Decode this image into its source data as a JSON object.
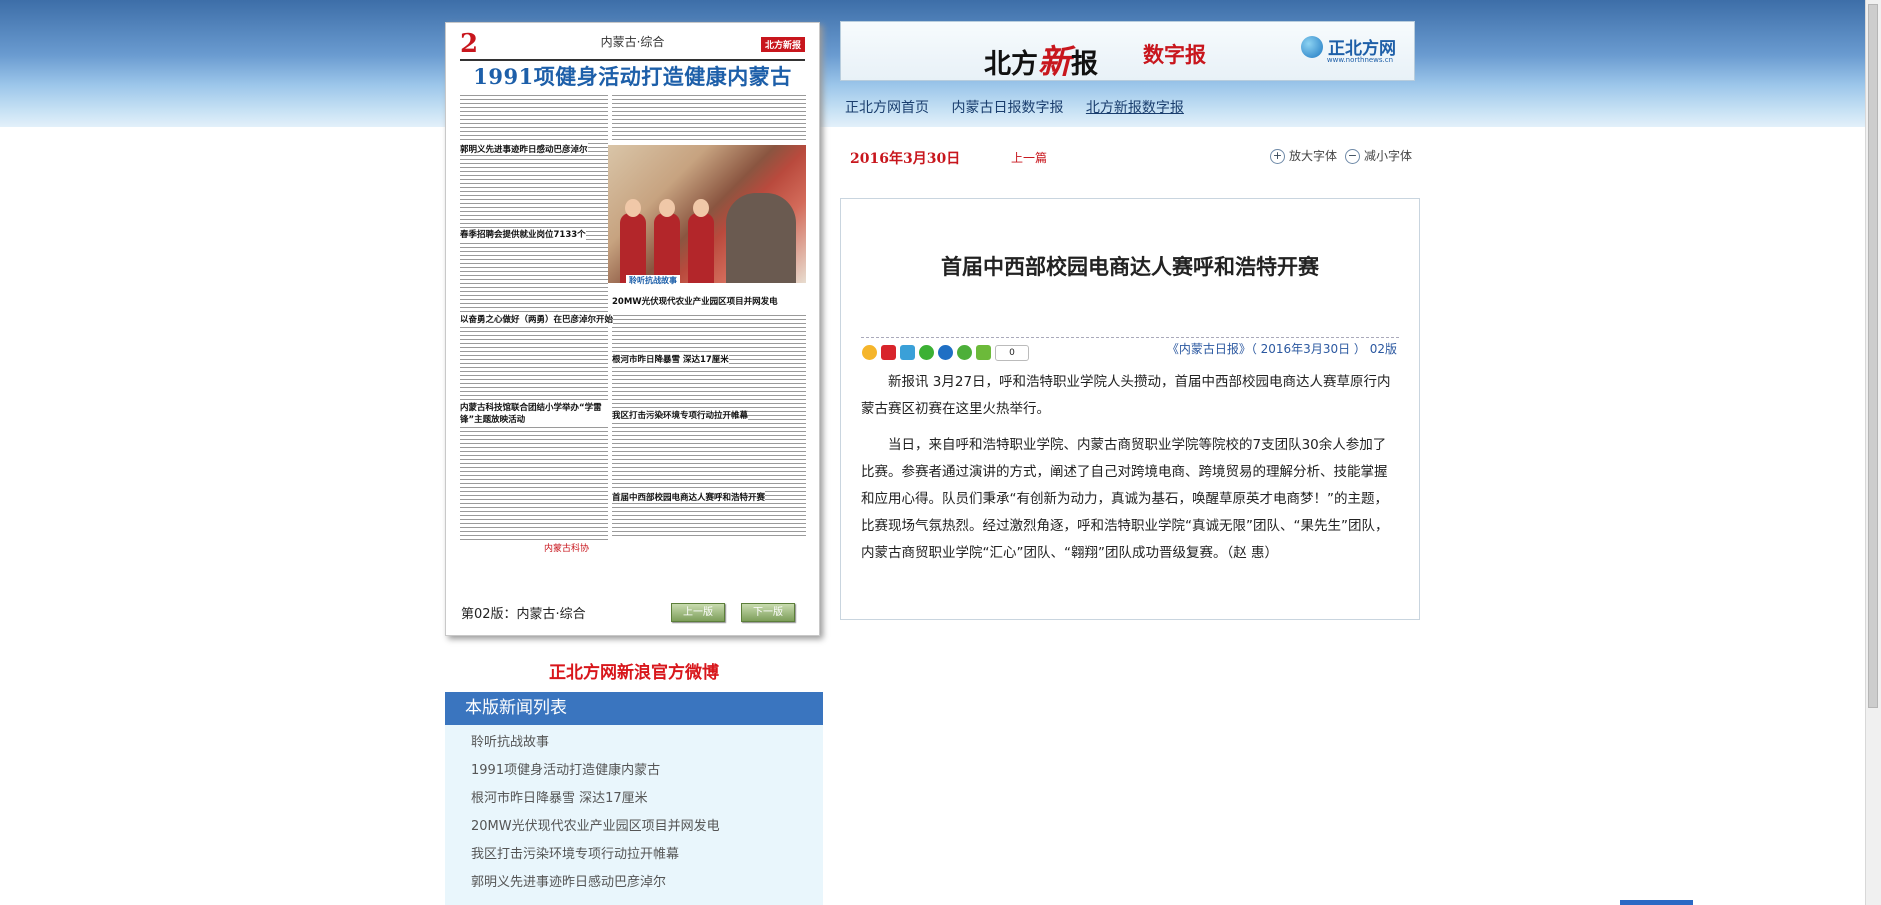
{
  "paper": {
    "page_number": "2",
    "section_header": "内蒙古·综合",
    "badge": "北方新报",
    "headline": "1991项健身活动打造健康内蒙古",
    "subheads": [
      "郭明义先进事迹昨日感动巴彦淖尔",
      "春季招聘会提供就业岗位7133个",
      "以奋勇之心做好（两勇）在巴彦淖尔开始",
      "内蒙古科技馆联合团结小学举办“学雷锋”主题放映活动",
      "20MW光伏现代农业产业园区项目并网发电",
      "根河市昨日降暴雪 深达17厘米",
      "我区打击污染环境专项行动拉开帷幕",
      "首届中西部校园电商达人赛呼和浩特开赛"
    ],
    "photo_caption": "聆听抗战故事",
    "paper_logo": "内蒙古科协",
    "footer_label": "第02版：内蒙古·综合",
    "prev_page": "上一版",
    "next_page": "下一版"
  },
  "weibo": "正北方网新浪官方微博",
  "newslist": {
    "title": "本版新闻列表",
    "items": [
      "聆听抗战故事",
      "1991项健身活动打造健康内蒙古",
      "根河市昨日降暴雪 深达17厘米",
      "20MW光伏现代农业产业园区项目并网发电",
      "我区打击污染环境专项行动拉开帷幕",
      "郭明义先进事迹昨日感动巴彦淖尔"
    ]
  },
  "header": {
    "brand_bf": "北方",
    "brand_xin": "新",
    "brand_bao": "报",
    "digital": "数字报",
    "site_name": "正北方网",
    "site_url": "www.northnews.cn"
  },
  "nav": [
    "正北方网首页",
    "内蒙古日报数字报",
    "北方新报数字报"
  ],
  "date": "2016年3月30日",
  "prev_article": "上一篇",
  "font": {
    "bigger": "放大字体",
    "smaller": "减小字体"
  },
  "article": {
    "title": "首届中西部校园电商达人赛呼和浩特开赛",
    "share_count": "0",
    "source": "《内蒙古日报》（ 2016年3月30日 ） 02版",
    "paragraphs": [
      "新报讯 3月27日，呼和浩特职业学院人头攒动，首届中西部校园电商达人赛草原行内蒙古赛区初赛在这里火热举行。",
      "当日，来自呼和浩特职业学院、内蒙古商贸职业学院等院校的7支团队30余人参加了比赛。参赛者通过演讲的方式，阐述了自己对跨境电商、跨境贸易的理解分析、技能掌握和应用心得。队员们秉承“有创新为动力，真诚为基石，唤醒草原英才电商梦！”的主题，比赛现场气氛热烈。经过激烈角逐，呼和浩特职业学院“真诚无限”团队、“果先生”团队，内蒙古商贸职业学院“汇心”团队、“翱翔”团队成功晋级复赛。（赵 惠）"
    ]
  },
  "colors": {
    "brand_red": "#c8161d",
    "brand_blue": "#1d5fa9",
    "list_header": "#3a75bf"
  }
}
